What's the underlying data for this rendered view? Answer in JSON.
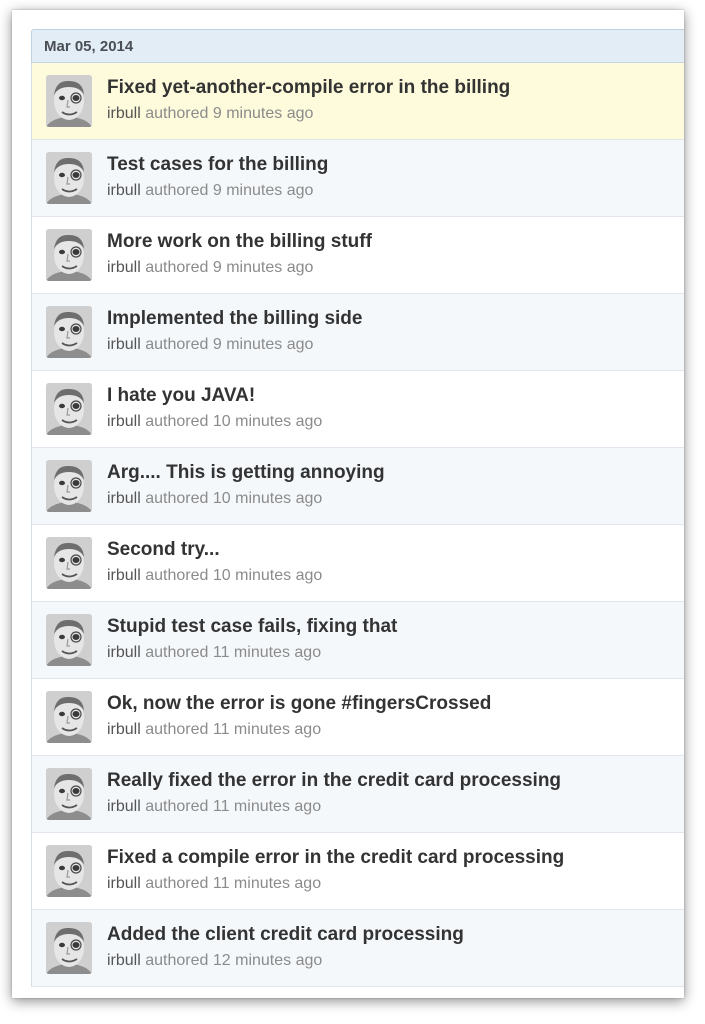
{
  "date_header": "Mar 05, 2014",
  "commits": [
    {
      "message": "Fixed yet-another-compile error in the billing",
      "author": "irbull",
      "authored_text": "authored",
      "time": "9 minutes ago"
    },
    {
      "message": "Test cases for the billing",
      "author": "irbull",
      "authored_text": "authored",
      "time": "9 minutes ago"
    },
    {
      "message": "More work on the billing stuff",
      "author": "irbull",
      "authored_text": "authored",
      "time": "9 minutes ago"
    },
    {
      "message": "Implemented the billing side",
      "author": "irbull",
      "authored_text": "authored",
      "time": "9 minutes ago"
    },
    {
      "message": "I hate you JAVA!",
      "author": "irbull",
      "authored_text": "authored",
      "time": "10 minutes ago"
    },
    {
      "message": "Arg.... This is getting annoying",
      "author": "irbull",
      "authored_text": "authored",
      "time": "10 minutes ago"
    },
    {
      "message": "Second try...",
      "author": "irbull",
      "authored_text": "authored",
      "time": "10 minutes ago"
    },
    {
      "message": "Stupid test case fails, fixing that",
      "author": "irbull",
      "authored_text": "authored",
      "time": "11 minutes ago"
    },
    {
      "message": "Ok, now the error is gone #fingersCrossed",
      "author": "irbull",
      "authored_text": "authored",
      "time": "11 minutes ago"
    },
    {
      "message": "Really fixed the error in the credit card processing",
      "author": "irbull",
      "authored_text": "authored",
      "time": "11 minutes ago"
    },
    {
      "message": "Fixed a compile error in the credit card processing",
      "author": "irbull",
      "authored_text": "authored",
      "time": "11 minutes ago"
    },
    {
      "message": "Added the client credit card processing",
      "author": "irbull",
      "authored_text": "authored",
      "time": "12 minutes ago"
    }
  ],
  "colors": {
    "header_bg": "#e3edf5",
    "highlight_row": "#fdfbdb",
    "alt_row": "#f4f8fb",
    "title_text": "#333333",
    "meta_text": "#8b8b8b"
  },
  "icons": {
    "avatar": "user-avatar-photo"
  }
}
